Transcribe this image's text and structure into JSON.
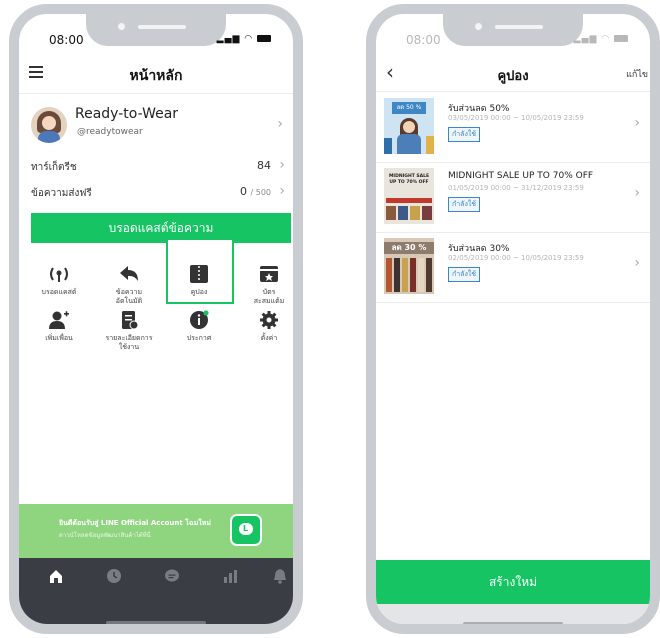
{
  "home": {
    "time": "08:00",
    "title": "หน้าหลัก",
    "profile": {
      "name": "Ready-to-Wear",
      "id": "@readytowear"
    },
    "friends_label": "ทาร์เก็ตรีช",
    "friends_value": "84",
    "messages_label": "ข้อความส่งฟรี",
    "messages_value": "0",
    "messages_limit": "/ 500",
    "broadcast_button": "บรอดแคสต์ข้อความ",
    "grid": [
      {
        "label": "บรอดแคสต์",
        "icon": "broadcast-icon"
      },
      {
        "label": "ข้อความ\nอัตโนมัติ",
        "icon": "reply-icon"
      },
      {
        "label": "คูปอง",
        "icon": "coupon-icon"
      },
      {
        "label": "บัตร\nสะสมแต้ม",
        "icon": "card-icon"
      },
      {
        "label": "เพิ่มเพื่อน",
        "icon": "add-friend-icon"
      },
      {
        "label": "รายละเอียดการ\nใช้งาน",
        "icon": "usage-icon"
      },
      {
        "label": "ประกาศ",
        "icon": "info-icon"
      },
      {
        "label": "ตั้งค่า",
        "icon": "gear-icon"
      }
    ],
    "banner": {
      "line1": "ยินดีต้อนรับสู่ LINE Official Account โฉมใหม่",
      "line2": "ดาวน์โหลดข้อมูลพัฒนาสินค้าได้ที่นี่"
    },
    "tabs": [
      "home-icon",
      "clock-icon",
      "chat-icon",
      "chart-icon",
      "bell-icon"
    ]
  },
  "coupons": {
    "time": "08:00",
    "title": "คูปอง",
    "edit": "แก้ไข",
    "items": [
      {
        "name": "รับส่วนลด 50%",
        "date": "03/05/2019 00:00 ~ 10/05/2019 23:59",
        "status": "กำลังใช้",
        "thumb_text": "ลด 50 %"
      },
      {
        "name": "MIDNIGHT SALE UP TO 70% OFF",
        "date": "01/05/2019 00:00 ~ 31/12/2019 23:59",
        "status": "กำลังใช้",
        "thumb_text": "MIDNIGHT SALE\nUP TO 70% OFF"
      },
      {
        "name": "รับส่วนลด 30%",
        "date": "02/05/2019 00:00 ~ 10/05/2019 23:59",
        "status": "กำลังใช้",
        "thumb_text": "ลด 30 %"
      }
    ],
    "create_button": "สร้างใหม่"
  },
  "colors": {
    "accent": "#16c464",
    "tabbar": "#3a3d44",
    "banner": "#8fd47f",
    "status": "#3a86c8"
  }
}
